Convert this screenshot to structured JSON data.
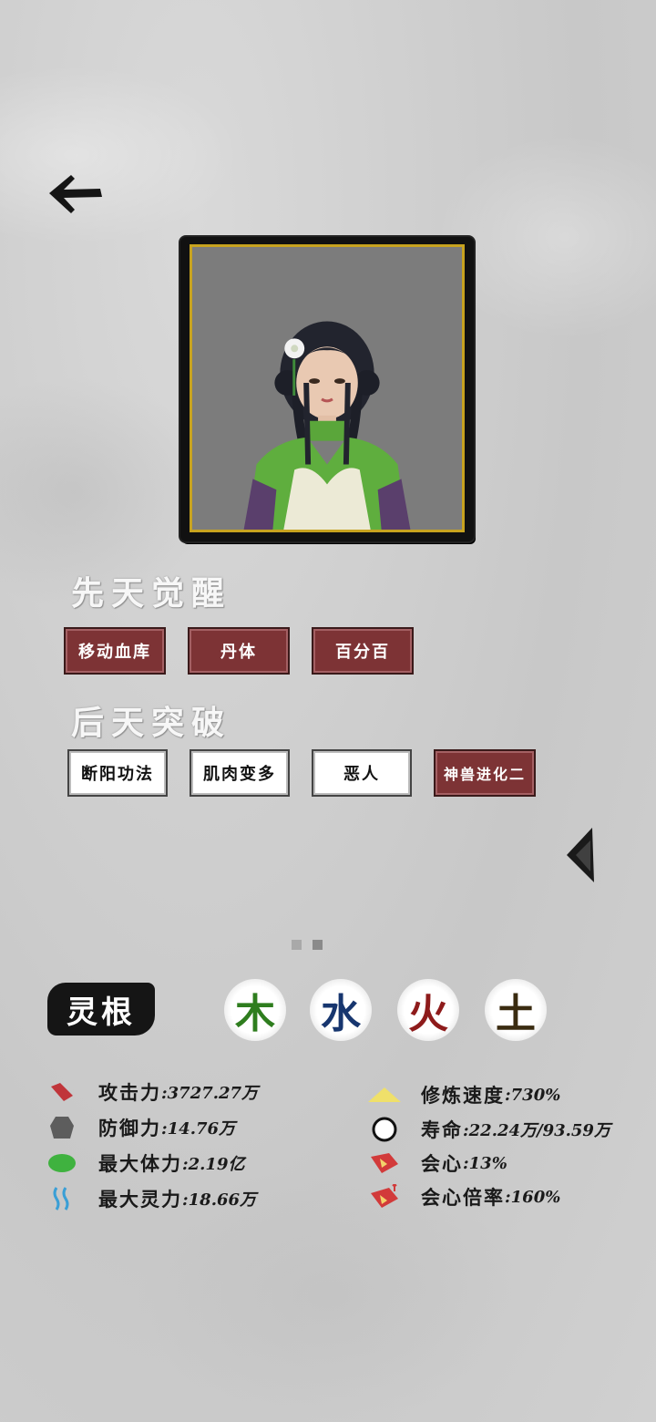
{
  "innate": {
    "title": "先天觉醒",
    "tags": [
      "移动血库",
      "丹体",
      "百分百"
    ]
  },
  "acquired": {
    "title": "后天突破",
    "tags": [
      "断阳功法",
      "肌肉变多",
      "恶人",
      "神兽进化二"
    ]
  },
  "spirit_root": {
    "label": "灵根",
    "elements": [
      {
        "char": "木",
        "color": "#2e7d1e"
      },
      {
        "char": "水",
        "color": "#17366f"
      },
      {
        "char": "火",
        "color": "#8e1b1b"
      },
      {
        "char": "土",
        "color": "#3a2b10"
      }
    ]
  },
  "stats_left": [
    {
      "label": "攻击力",
      "value": ":3727.27万",
      "icon": "attack-icon"
    },
    {
      "label": "防御力",
      "value": ":14.76万",
      "icon": "defense-icon"
    },
    {
      "label": "最大体力",
      "value": ":2.19亿",
      "icon": "hp-icon"
    },
    {
      "label": "最大灵力",
      "value": ":18.66万",
      "icon": "mana-icon"
    }
  ],
  "stats_right": [
    {
      "label": "修炼速度",
      "value": ":730%",
      "icon": "cultivation-speed-icon"
    },
    {
      "label": "寿命",
      "value": ":22.24万/93.59万",
      "icon": "lifespan-icon"
    },
    {
      "label": "会心",
      "value": ":13%",
      "icon": "crit-icon"
    },
    {
      "label": "会心倍率",
      "value": ":160%",
      "icon": "crit-multiplier-icon"
    }
  ],
  "colors": {
    "tag_red": "#7d3335",
    "frame_gold": "#c8a31f"
  }
}
